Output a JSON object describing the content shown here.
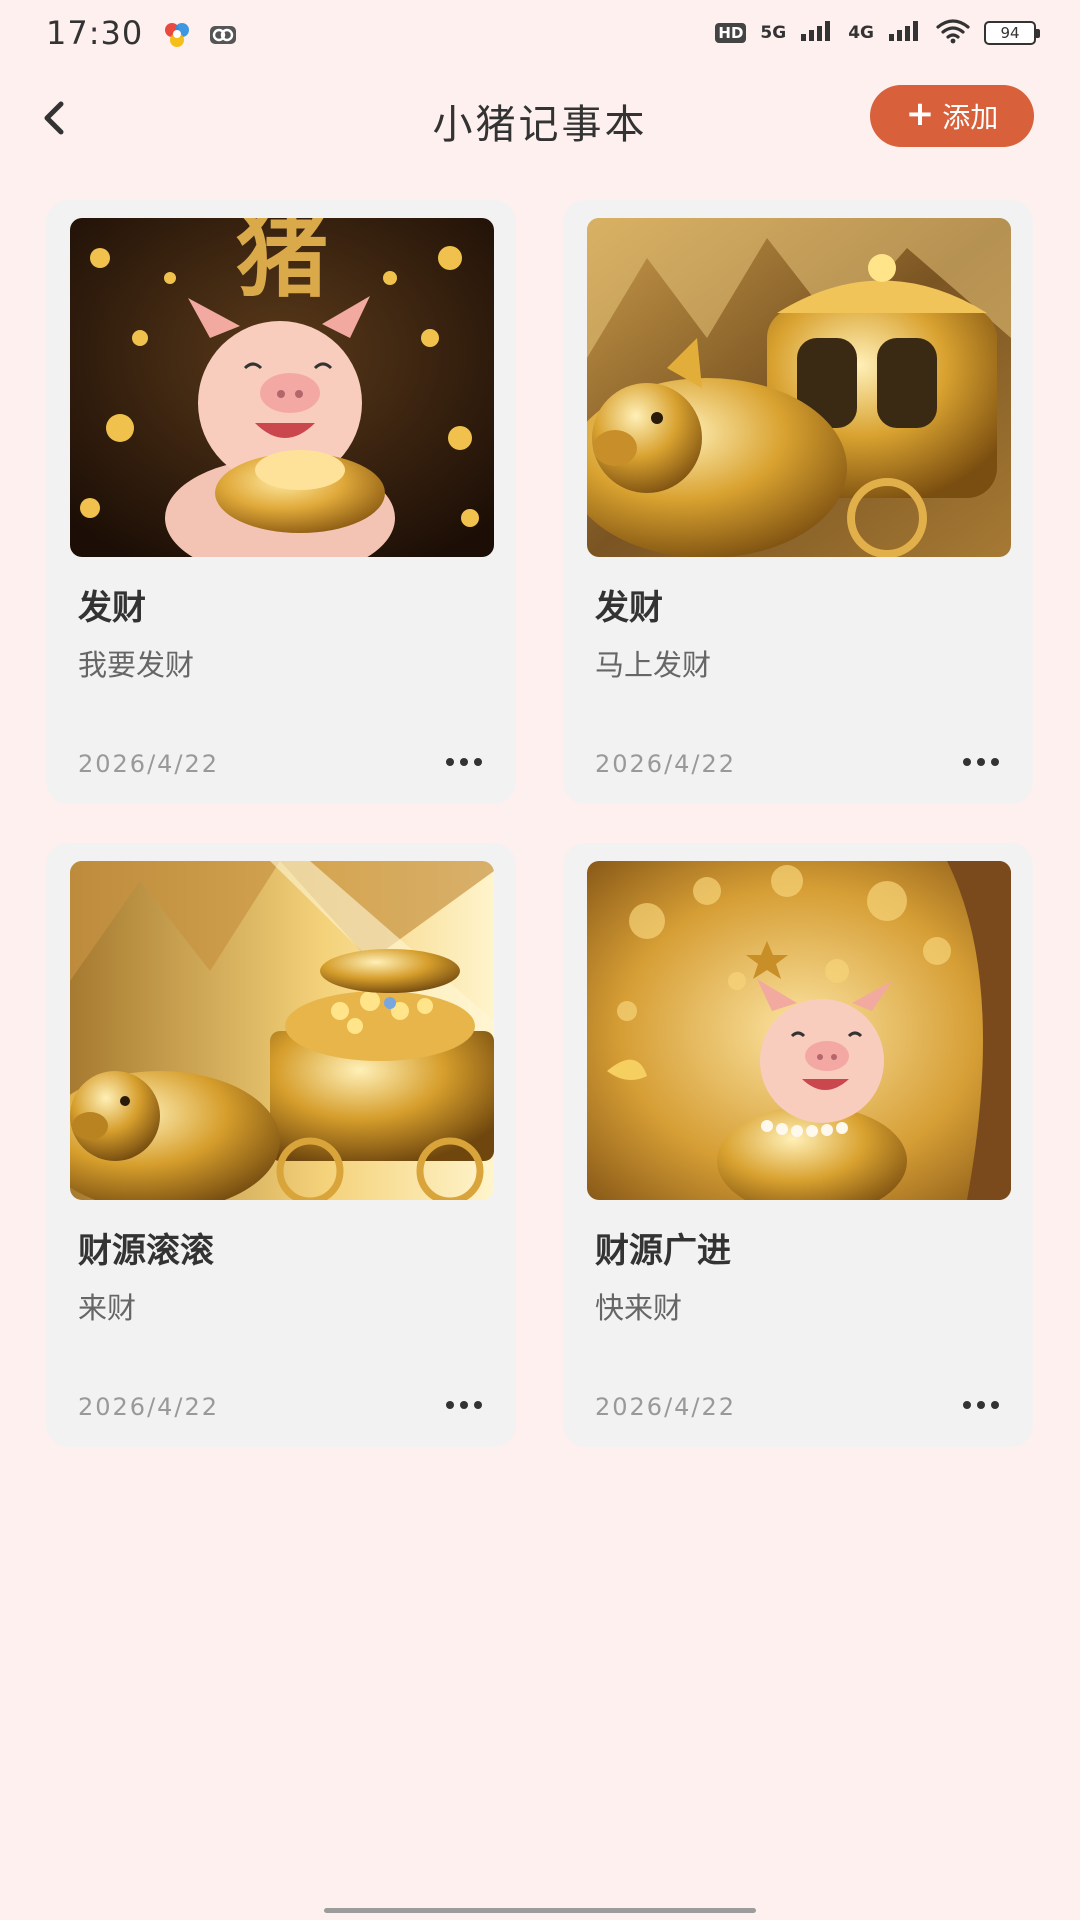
{
  "status_bar": {
    "time": "17:30",
    "hd_label": "HD",
    "net_5g": "5G",
    "net_4g": "4G",
    "battery": "94"
  },
  "header": {
    "title": "小猪记事本",
    "add_label": "添加",
    "add_icon": "plus-icon",
    "back_icon": "chevron-left-icon"
  },
  "colors": {
    "background": "#fdf0ee",
    "accent": "#d8603a",
    "card": "#f2f2f2"
  },
  "notes": [
    {
      "title": "发财",
      "desc": "我要发财",
      "date": "2026/4/22",
      "image": "pig-with-gold-ingot-image",
      "image_text": "猪"
    },
    {
      "title": "发财",
      "desc": "马上发财",
      "date": "2026/4/22",
      "image": "golden-pig-carriage-image"
    },
    {
      "title": "财源滚滚",
      "desc": "来财",
      "date": "2026/4/22",
      "image": "golden-pig-treasure-image"
    },
    {
      "title": "财源广进",
      "desc": "快来财",
      "date": "2026/4/22",
      "image": "pig-gold-forest-image"
    }
  ]
}
